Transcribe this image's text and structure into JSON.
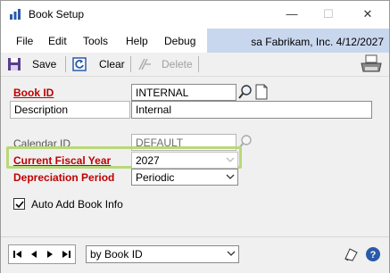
{
  "window": {
    "title": "Book Setup",
    "minimize": "—",
    "maximize": "☐",
    "close": "✕"
  },
  "menu": [
    "File",
    "Edit",
    "Tools",
    "Help",
    "Debug"
  ],
  "user_info": "sa  Fabrikam, Inc.  4/12/2027",
  "toolbar": {
    "save": "Save",
    "clear": "Clear",
    "delete": "Delete"
  },
  "form": {
    "book_id": {
      "label": "Book ID",
      "value": "INTERNAL"
    },
    "description": {
      "label": "Description",
      "value": "Internal"
    },
    "calendar_id": {
      "label": "Calendar ID",
      "value": "DEFAULT"
    },
    "fiscal_year": {
      "label": "Current Fiscal Year",
      "value": "2027"
    },
    "depreciation": {
      "label": "Depreciation Period",
      "value": "Periodic"
    },
    "auto_add": {
      "label": "Auto Add Book Info",
      "checked": true
    }
  },
  "bottom": {
    "sort": "by Book ID"
  },
  "colors": {
    "required_label": "#c00000",
    "highlight": "#b9d879",
    "user_bar": "#c9d7ee"
  }
}
